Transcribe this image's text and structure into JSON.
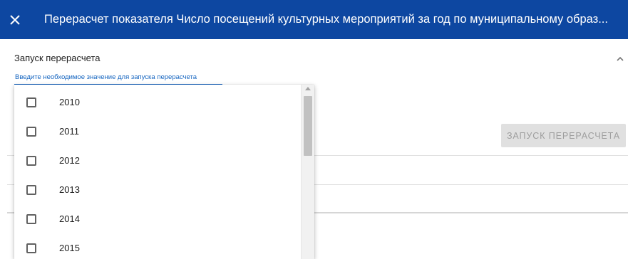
{
  "header": {
    "title": "Перерасчет показателя Число посещений культурных мероприятий за год по муниципальному образ...",
    "close_icon": "close-icon",
    "background_color": "#0d47a1"
  },
  "section": {
    "title": "Запуск перерасчета",
    "chevron_icon": "chevron-up-icon"
  },
  "field": {
    "label": "Введите необходимое значение для запуска перерасчета",
    "accent_color": "#1565c0"
  },
  "run_button": {
    "label": "ЗАПУСК ПЕРЕРАСЧЕТА",
    "disabled": true
  },
  "dropdown": {
    "options": [
      {
        "label": "2010",
        "checked": false
      },
      {
        "label": "2011",
        "checked": false
      },
      {
        "label": "2012",
        "checked": false
      },
      {
        "label": "2013",
        "checked": false
      },
      {
        "label": "2014",
        "checked": false
      },
      {
        "label": "2015",
        "checked": false
      }
    ]
  }
}
